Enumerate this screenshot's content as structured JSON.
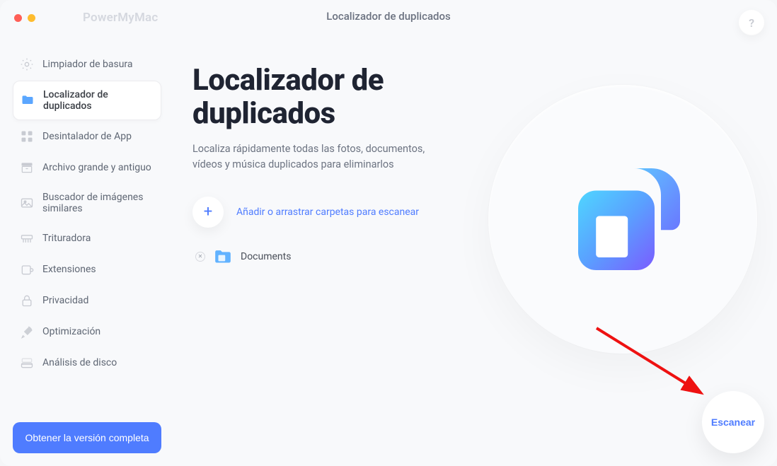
{
  "app_name": "PowerMyMac",
  "header": {
    "title": "Localizador de duplicados",
    "help_label": "?"
  },
  "sidebar": {
    "items": [
      {
        "label": "Limpiador de basura",
        "icon": "gear"
      },
      {
        "label": "Localizador de duplicados",
        "icon": "folder-color"
      },
      {
        "label": "Desintalador de App",
        "icon": "grid"
      },
      {
        "label": "Archivo grande y antiguo",
        "icon": "box"
      },
      {
        "label": "Buscador de imágenes similares",
        "icon": "image"
      },
      {
        "label": "Trituradora",
        "icon": "shred"
      },
      {
        "label": "Extensiones",
        "icon": "puzzle"
      },
      {
        "label": "Privacidad",
        "icon": "lock"
      },
      {
        "label": "Optimización",
        "icon": "rocket"
      },
      {
        "label": "Análisis de disco",
        "icon": "disk"
      }
    ],
    "active_index": 1,
    "cta_label": "Obtener la versión completa"
  },
  "main": {
    "heading": "Localizador de duplicados",
    "subtext": "Localiza rápidamente todas las fotos, documentos, vídeos y música duplicados para eliminarlos",
    "add_label": "Añadir o arrastrar carpetas para escanear",
    "folders": [
      {
        "name": "Documents"
      }
    ],
    "scan_label": "Escanear"
  },
  "colors": {
    "accent": "#4f7cff",
    "text_muted": "#6d7482"
  }
}
